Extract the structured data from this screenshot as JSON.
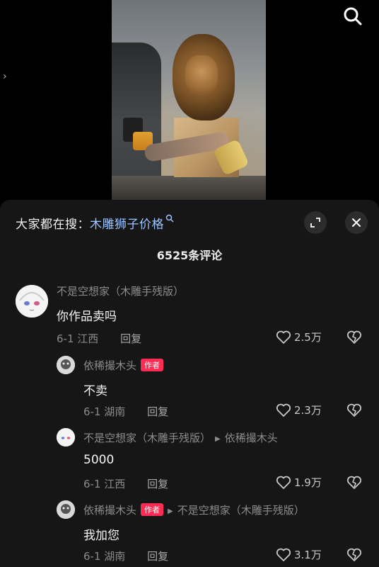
{
  "header": {
    "search_icon": "search-icon",
    "side_arrow": "›"
  },
  "panel": {
    "search_prefix": "大家都在搜：",
    "search_keyword": "木雕狮子价格",
    "comment_count": "6525条评论"
  },
  "comments": [
    {
      "user": "不是空想家（木雕手残版）",
      "text": "你作品卖吗",
      "date": "6-1",
      "location": "江西",
      "reply_label": "回复",
      "likes": "2.5万"
    },
    {
      "user": "依稀撮木头",
      "badge": "作者",
      "text": "不卖",
      "date": "6-1",
      "location": "湖南",
      "reply_label": "回复",
      "likes": "2.3万"
    },
    {
      "user": "不是空想家（木雕手残版）",
      "reply_to": "依稀撮木头",
      "text": "5000",
      "date": "6-1",
      "location": "江西",
      "reply_label": "回复",
      "likes": "1.9万"
    },
    {
      "user": "依稀撮木头",
      "badge": "作者",
      "reply_to": "不是空想家（木雕手残版）",
      "text": "我加您",
      "date": "6-1",
      "location": "湖南",
      "reply_label": "回复",
      "likes": "3.1万"
    }
  ],
  "colors": {
    "keyword": "#9cc5ff",
    "author_badge": "#fe2c55",
    "panel_bg": "#161616"
  }
}
